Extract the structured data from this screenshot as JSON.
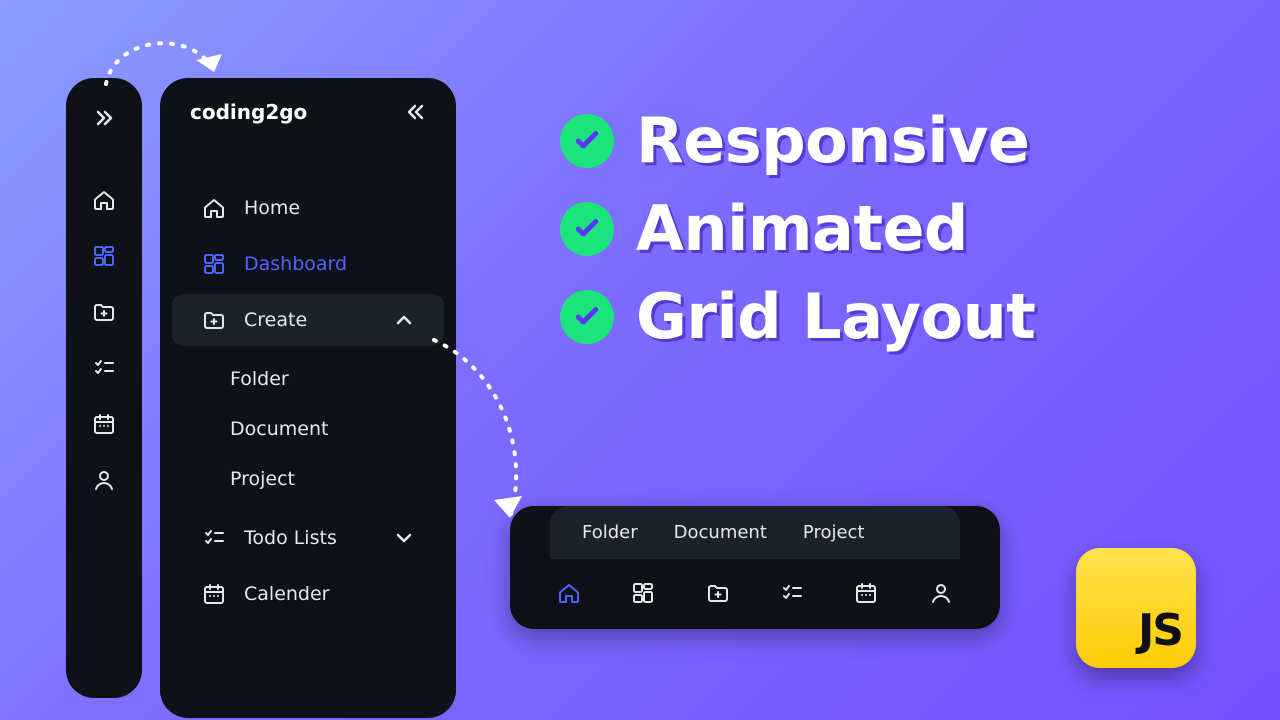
{
  "brand": "coding2go",
  "mini_sidebar": {
    "items": [
      {
        "icon": "home",
        "active": false
      },
      {
        "icon": "dashboard",
        "active": true
      },
      {
        "icon": "create",
        "active": false
      },
      {
        "icon": "todo",
        "active": false
      },
      {
        "icon": "calendar",
        "active": false
      },
      {
        "icon": "profile",
        "active": false
      }
    ]
  },
  "sidebar": {
    "items": [
      {
        "icon": "home",
        "label": "Home",
        "active": false,
        "open": false
      },
      {
        "icon": "dashboard",
        "label": "Dashboard",
        "active": true,
        "open": false
      },
      {
        "icon": "create",
        "label": "Create",
        "active": false,
        "open": true,
        "children": [
          "Folder",
          "Document",
          "Project"
        ]
      },
      {
        "icon": "todo",
        "label": "Todo Lists",
        "active": false,
        "open": false,
        "expandable": true
      },
      {
        "icon": "calendar",
        "label": "Calender",
        "active": false,
        "open": false
      }
    ]
  },
  "hero": {
    "lines": [
      "Responsive",
      "Animated",
      "Grid Layout"
    ]
  },
  "bottom_nav": {
    "submenu": [
      "Folder",
      "Document",
      "Project"
    ],
    "items": [
      {
        "icon": "home",
        "active": true
      },
      {
        "icon": "dashboard",
        "active": false
      },
      {
        "icon": "create",
        "active": false
      },
      {
        "icon": "todo",
        "active": false
      },
      {
        "icon": "calendar",
        "active": false
      },
      {
        "icon": "profile",
        "active": false
      }
    ]
  },
  "js_badge": {
    "label": "JS"
  }
}
